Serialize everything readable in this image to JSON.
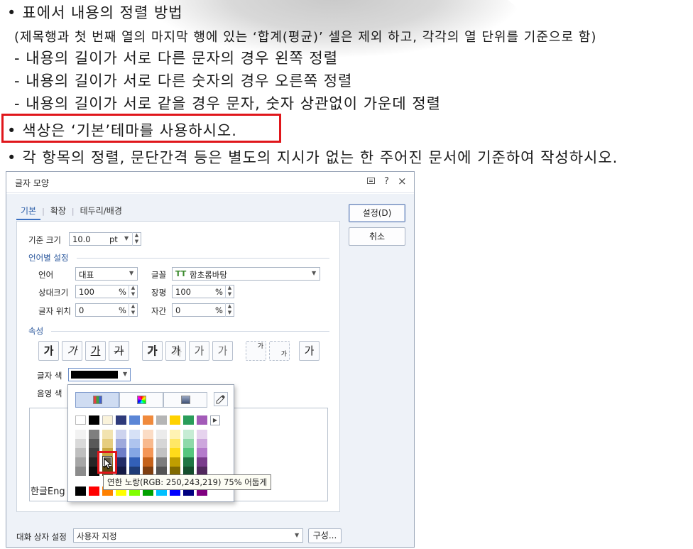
{
  "document": {
    "heading": "표에서 내용의 정렬 방법",
    "note": "(제목행과 첫 번째 열의 마지막 행에 있는 ‘합계(평균)’ 셀은 제외 하고, 각각의 열 단위를 기준으로 함)",
    "rules": [
      "- 내용의 길이가 서로 다른 문자의 경우 왼쪽 정렬",
      "- 내용의 길이가 서로 다른 숫자의 경우 오른쪽 정렬",
      "- 내용의 길이가 서로 같을 경우 문자, 숫자 상관없이 가운데 정렬"
    ],
    "color_instruction": "색상은 ‘기본’테마를 사용하시오.",
    "alignment_instruction": "각 항목의 정렬, 문단간격 등은 별도의 지시가 없는 한 주어진 문서에 기준하여 작성하시오.",
    "bullet": "•"
  },
  "dialog": {
    "title": "글자 모양",
    "titlebar_icons": {
      "help": "?",
      "close": "×"
    },
    "tabs": [
      {
        "label": "기본",
        "active": true
      },
      {
        "label": "확장",
        "active": false
      },
      {
        "label": "테두리/배경",
        "active": false
      }
    ],
    "buttons": {
      "ok": "설정(D)",
      "cancel": "취소"
    },
    "base_size": {
      "label": "기준 크기",
      "value": "10.0",
      "unit": "pt"
    },
    "lang_section": "언어별 설정",
    "language": {
      "label": "언어",
      "value": "대표"
    },
    "font": {
      "label": "글꼴",
      "value": "함초롬바탕",
      "icon": "TT"
    },
    "relative_size": {
      "label": "상대크기",
      "value": "100",
      "unit": "%"
    },
    "width_ratio": {
      "label": "장평",
      "value": "100",
      "unit": "%"
    },
    "position": {
      "label": "글자 위치",
      "value": "0",
      "unit": "%"
    },
    "spacing": {
      "label": "자간",
      "value": "0",
      "unit": "%"
    },
    "attr_section": "속성",
    "attr_buttons": [
      "가",
      "가",
      "가",
      "가",
      "가",
      "가",
      "가",
      "가",
      "가",
      "가",
      "가"
    ],
    "text_color_label": "글자 색",
    "shade_color_label": "음영 색",
    "preview_text": "한글Eng",
    "dialog_settings_label": "대화 상자 설정",
    "dialog_settings_value": "사용자 지정",
    "compose_button": "구성..."
  },
  "color_popup": {
    "tooltip": "연한 노랑(RGB: 250,243,219) 75% 어둡게",
    "theme_row": [
      "#ffffff",
      "#000000",
      "#faf3db",
      "#2e3a7a",
      "#5b86d6",
      "#f08a3c",
      "#b5b5b5",
      "#ffd200",
      "#2a9d5a",
      "#a35bb8"
    ],
    "theme_columns": [
      [
        "#f2f2f2",
        "#d9d9d9",
        "#bfbfbf",
        "#a6a6a6",
        "#8c8c8c"
      ],
      [
        "#7f7f7f",
        "#595959",
        "#404040",
        "#262626",
        "#0d0d0d"
      ],
      [
        "#f2e3b0",
        "#e6cd7e",
        "#c9a941",
        "#8a6d1c",
        "#5a4710"
      ],
      [
        "#cdd3ee",
        "#9ea9dc",
        "#6f7ec8",
        "#222c66",
        "#141a44"
      ],
      [
        "#d6e1f6",
        "#aec4ee",
        "#85a6e4",
        "#3360b8",
        "#1f3c76"
      ],
      [
        "#fbdcc5",
        "#f8b98d",
        "#f49656",
        "#c5621a",
        "#7f3f10"
      ],
      [
        "#ebebeb",
        "#d6d6d6",
        "#c2c2c2",
        "#7d7d7d",
        "#545454"
      ],
      [
        "#fff3b3",
        "#ffe766",
        "#ffdb1a",
        "#bf9e00",
        "#806a00"
      ],
      [
        "#c6ecd4",
        "#8ed9a9",
        "#55c67e",
        "#1f7643",
        "#144e2c"
      ],
      [
        "#e6d3ee",
        "#cda7dd",
        "#b47bcb",
        "#7a3c8c",
        "#51285d"
      ]
    ],
    "standard_row": [
      "#000000",
      "#ff0000",
      "#ff8000",
      "#ffff00",
      "#80ff00",
      "#00a000",
      "#00c0ff",
      "#0000ff",
      "#000080",
      "#800080"
    ]
  }
}
